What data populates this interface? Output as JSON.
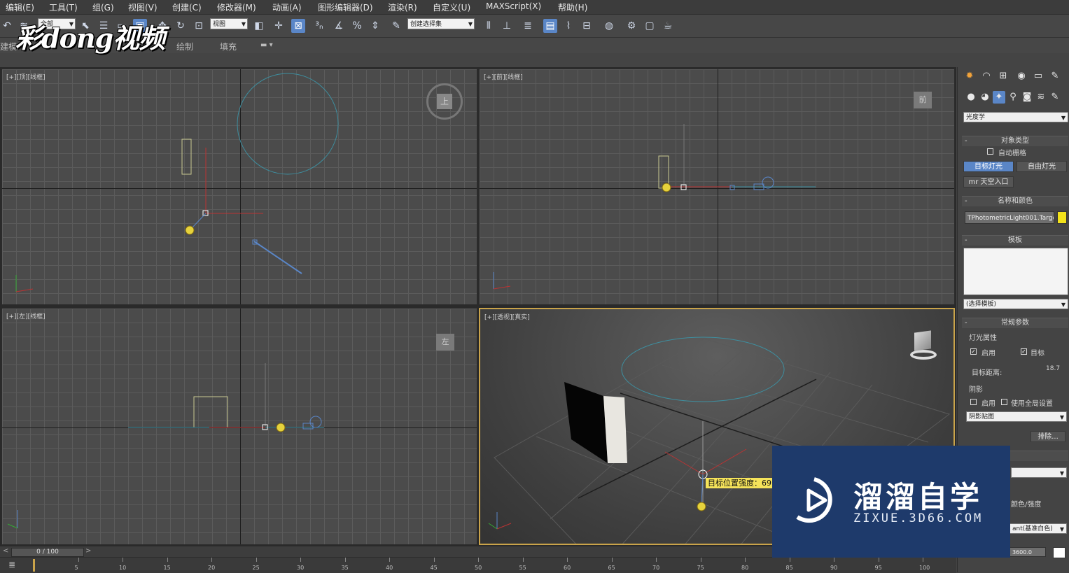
{
  "menu": [
    "编辑(E)",
    "工具(T)",
    "组(G)",
    "视图(V)",
    "创建(C)",
    "修改器(M)",
    "动画(A)",
    "图形编辑器(D)",
    "渲染(R)",
    "自定义(U)",
    "MAXScript(X)",
    "帮助(H)"
  ],
  "toolbar": {
    "all_select": "全部",
    "view_select": "视图",
    "selection_set": "创建选择集",
    "icons": [
      "undo-icon",
      "redo-icon",
      "link-icon",
      "select-icon",
      "select-by-name-icon",
      "region-select-icon",
      "window-crossing-icon",
      "move-icon",
      "rotate-icon",
      "scale-icon",
      "reference-coord-icon",
      "pivot-icon",
      "select-manipulate-icon",
      "snap-icon",
      "angle-snap-icon",
      "percent-snap-icon",
      "spinner-snap-icon",
      "edit-named-sel-icon",
      "mirror-icon",
      "align-icon",
      "layer-icon",
      "graphite-icon",
      "curve-editor-icon",
      "schematic-icon",
      "material-editor-icon",
      "render-setup-icon",
      "render-frame-icon",
      "render-icon"
    ]
  },
  "ribbon": {
    "left": "建模",
    "mid": "绘制",
    "fill": "填充"
  },
  "logo": "彩dong视频",
  "viewports": {
    "top": "[+][顶][线框]",
    "front": "[+][前][线框]",
    "left": "[+][左][线框]",
    "persp": "[+][透视][真实]"
  },
  "viewcube": {
    "top": "上",
    "front": "前",
    "left": "左"
  },
  "tooltip": "目标位置强度：69",
  "panel": {
    "category": "光度学",
    "object_type": "对象类型",
    "auto_grid": "自动栅格",
    "target_light": "目标灯光",
    "free_light": "自由灯光",
    "sky_portal": "mr 天空入口",
    "name_color": "名称和颜色",
    "object_name": "TPhotometricLight001.Target",
    "template": "模板",
    "template_select": "(选择模板)",
    "general": "常规参数",
    "light_props": "灯光属性",
    "enable": "启用",
    "targeted": "目标",
    "target_dist_label": "目标距离:",
    "target_dist": "18.7",
    "shadows": "阴影",
    "shadow_enable": "启用",
    "use_global": "使用全局设置",
    "shadow_type": "阴影贴图",
    "exclude": "排除...",
    "color_label": "颜色/强度",
    "color_preset": "ant(基准白色)",
    "kelvin": "3600.0"
  },
  "timeline": {
    "frame": "0 / 100",
    "ticks": [
      "5",
      "10",
      "15",
      "20",
      "25",
      "30",
      "35",
      "40",
      "45",
      "50",
      "55",
      "60",
      "65",
      "70",
      "75",
      "80",
      "85",
      "90",
      "95",
      "100"
    ]
  },
  "watermark": {
    "title": "溜溜自学",
    "sub": "ZIXUE.3D66.COM"
  },
  "colors": {
    "accent": "#5a86c7",
    "viewport_border_active": "#c9a34a",
    "watermark_bg": "#1e3a6b",
    "light_yellow": "#e6d23c"
  }
}
